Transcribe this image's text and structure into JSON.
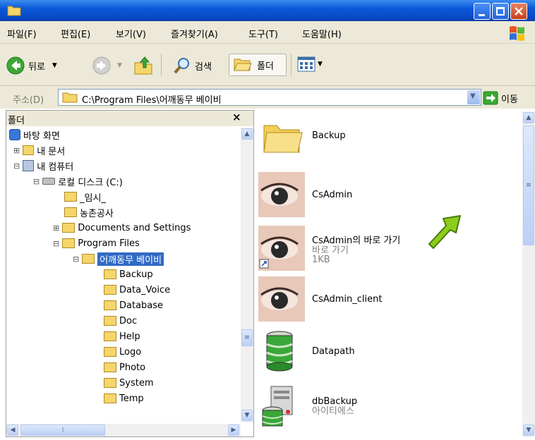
{
  "menu": [
    "파일(F)",
    "편집(E)",
    "보기(V)",
    "즐겨찾기(A)",
    "도구(T)",
    "도움말(H)"
  ],
  "toolbar": {
    "back": "뒤로",
    "search": "검색",
    "folders": "폴더"
  },
  "address": {
    "label": "주소(D)",
    "path": "C:\\Program Files\\어깨동무 베이비",
    "go": "이동"
  },
  "folder_pane": {
    "title": "폴더",
    "close": "×",
    "tree": [
      {
        "label": "바탕 화면"
      },
      {
        "label": "내 문서"
      },
      {
        "label": "내 컴퓨터"
      },
      {
        "label": "로컬 디스크 (C:)"
      },
      {
        "label": "_임시_"
      },
      {
        "label": "농촌공사"
      },
      {
        "label": "Documents and Settings"
      },
      {
        "label": "Program Files"
      },
      {
        "label": "어깨동무 베이비"
      },
      {
        "label": "Backup"
      },
      {
        "label": "Data_Voice"
      },
      {
        "label": "Database"
      },
      {
        "label": "Doc"
      },
      {
        "label": "Help"
      },
      {
        "label": "Logo"
      },
      {
        "label": "Photo"
      },
      {
        "label": "System"
      },
      {
        "label": "Temp"
      }
    ]
  },
  "files": [
    {
      "name": "Backup",
      "sub1": "",
      "sub2": "",
      "icon": "folder-icon"
    },
    {
      "name": "CsAdmin",
      "sub1": "",
      "sub2": "",
      "icon": "eye-icon"
    },
    {
      "name": "CsAdmin의 바로 가기",
      "sub1": "바로 가기",
      "sub2": "1KB",
      "icon": "eye-icon"
    },
    {
      "name": "CsAdmin_client",
      "sub1": "",
      "sub2": "",
      "icon": "eye-icon"
    },
    {
      "name": "Datapath",
      "sub1": "",
      "sub2": "",
      "icon": "database-icon"
    },
    {
      "name": "dbBackup",
      "sub1": "아이티에스",
      "sub2": "",
      "icon": "server-icon"
    }
  ],
  "colors": {
    "titlebar": "#0a58d8",
    "selection": "#316ac5",
    "chrome": "#ece9d8",
    "arrow": "#8ccc1a"
  }
}
